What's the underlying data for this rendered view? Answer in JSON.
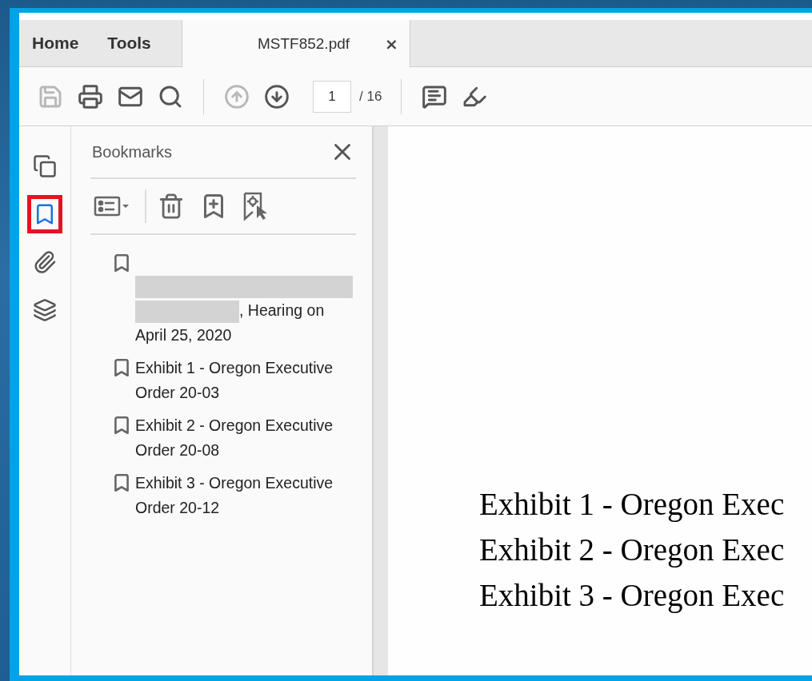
{
  "tabs": [
    {
      "label": "Home",
      "kind": "nav",
      "selected": false
    },
    {
      "label": "Tools",
      "kind": "nav",
      "selected": false
    },
    {
      "label": "MSTF852.pdf",
      "kind": "document",
      "selected": true,
      "close": "×"
    }
  ],
  "toolbar": {
    "items": [
      {
        "kind": "save",
        "disabled": true
      },
      {
        "kind": "print",
        "disabled": false
      },
      {
        "kind": "mail",
        "disabled": false
      },
      {
        "kind": "search",
        "disabled": false
      },
      {
        "kind": "separator"
      },
      {
        "kind": "prev-page",
        "disabled": true
      },
      {
        "kind": "next-page",
        "disabled": false
      },
      {
        "kind": "page",
        "value": "1",
        "total": "/ 16"
      },
      {
        "kind": "separator"
      },
      {
        "kind": "comment",
        "disabled": false
      },
      {
        "kind": "highlight",
        "disabled": false
      }
    ]
  },
  "rail": [
    {
      "kind": "pages",
      "selected": false
    },
    {
      "kind": "bookmarks",
      "selected": true
    },
    {
      "kind": "attachments",
      "selected": false
    },
    {
      "kind": "layers",
      "selected": false
    }
  ],
  "bookmarks_panel": {
    "title": "Bookmarks",
    "tools": [
      {
        "kind": "options"
      },
      {
        "kind": "separator"
      },
      {
        "kind": "delete"
      },
      {
        "kind": "new"
      },
      {
        "kind": "new-from-selection"
      }
    ],
    "items": [
      {
        "redacted": true,
        "text": ", Hearing on April 25, 2020"
      },
      {
        "redacted": false,
        "text": "Exhibit 1 - Oregon Executive Order 20-03"
      },
      {
        "redacted": false,
        "text": "Exhibit 2 - Oregon Executive Order 20-08"
      },
      {
        "redacted": false,
        "text": "Exhibit 3 - Oregon Executive Order 20-12"
      }
    ]
  },
  "document": {
    "lines": [
      "Exhibit 1 - Oregon Exec",
      "Exhibit 2 - Oregon Exec",
      "Exhibit 3 - Oregon Exec"
    ]
  }
}
